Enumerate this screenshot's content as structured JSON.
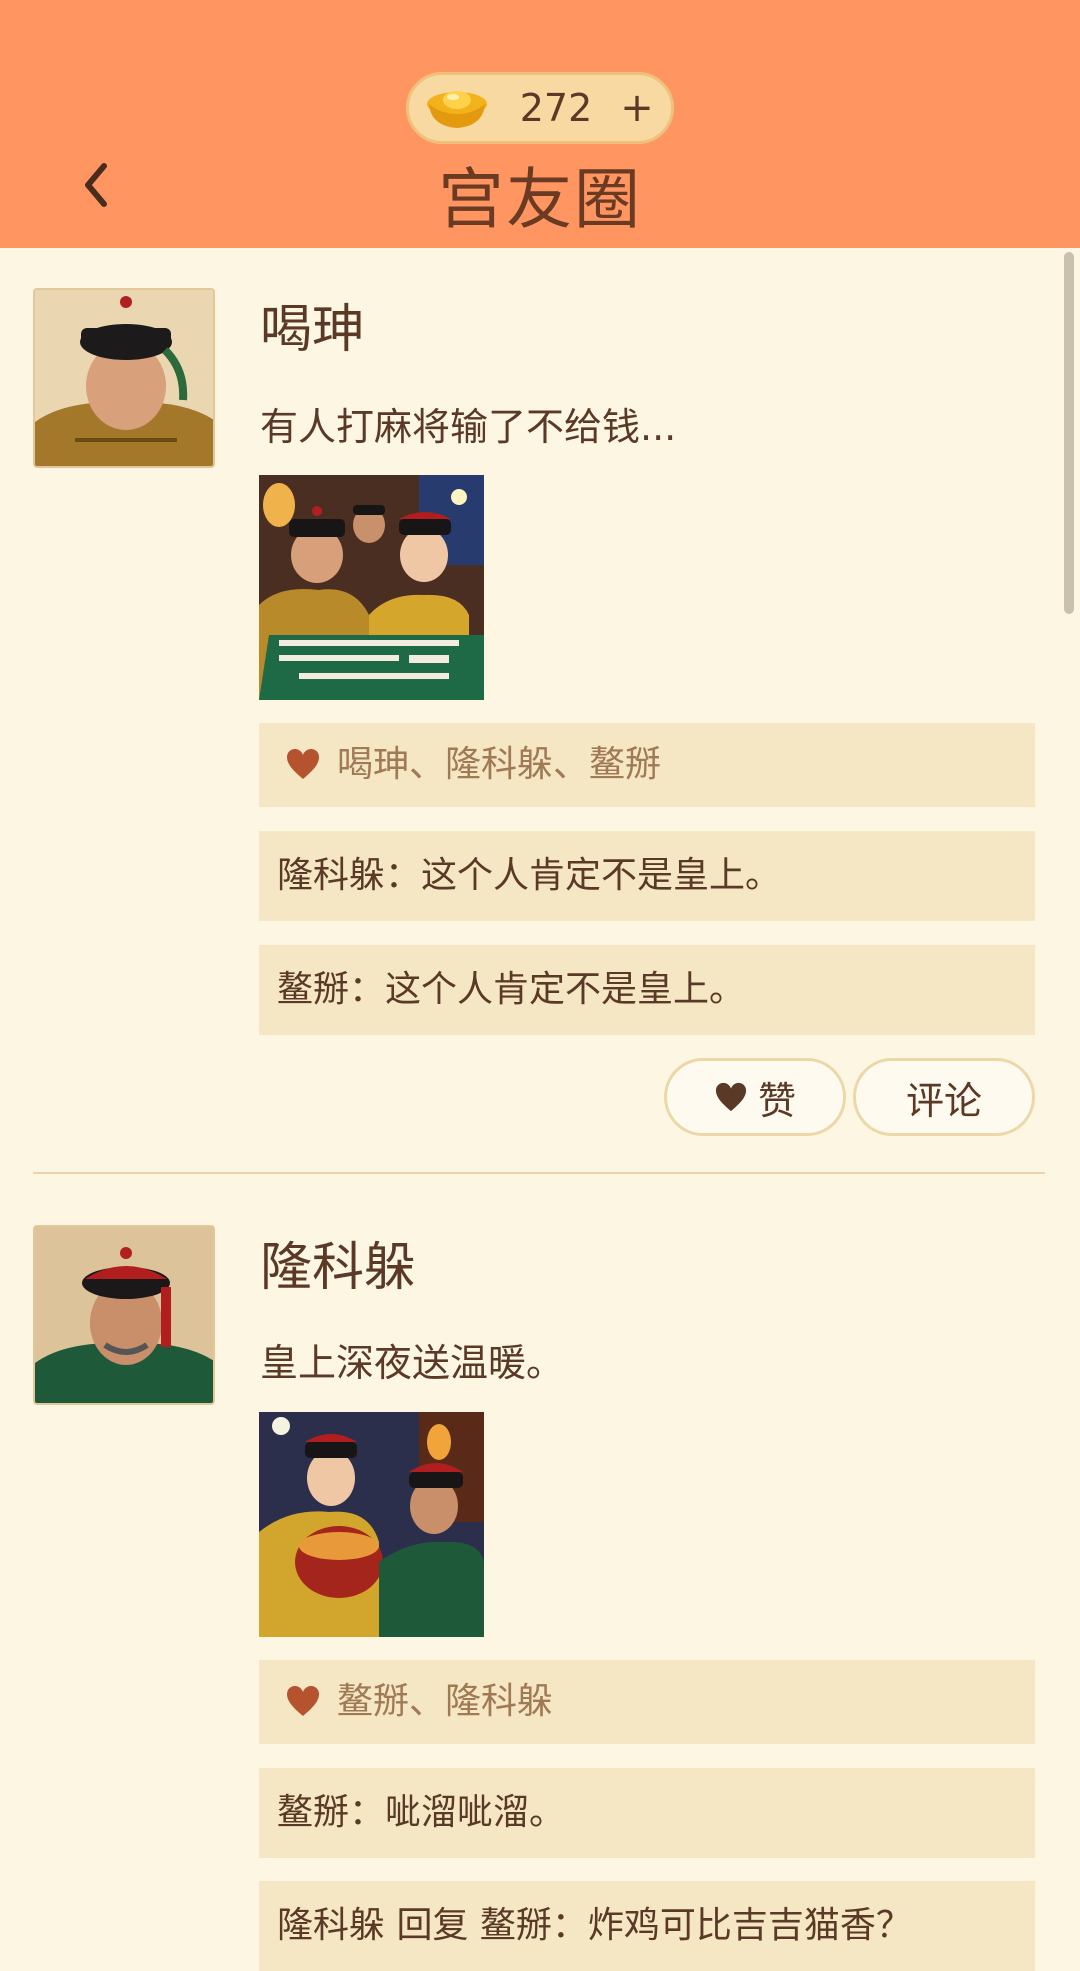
{
  "header": {
    "coins": "272",
    "plus_label": "+",
    "title": "宫友圈",
    "coin_icon": "gold-ingot-icon",
    "back_icon": "chevron-left-icon"
  },
  "colors": {
    "header_bg": "#ff9662",
    "page_bg": "#fdf6e2",
    "panel_bg": "#f5e6c4",
    "text": "#5a3a26",
    "heart": "#b4532e"
  },
  "posts": [
    {
      "name": "喝珅",
      "text": "有人打麻将输了不给钱...",
      "image_alt": "mahjong-scene-image",
      "likes": "喝珅、隆科躲、鳌掰",
      "comments": [
        "隆科躲：这个人肯定不是皇上。",
        "鳌掰：这个人肯定不是皇上。"
      ],
      "like_label": "赞",
      "comment_label": "评论"
    },
    {
      "name": "隆科躲",
      "text": "皇上深夜送温暖。",
      "image_alt": "food-gift-scene-image",
      "likes": "鳌掰、隆科躲",
      "comments": [
        "鳌掰：呲溜呲溜。",
        "隆科躲 回复 鳌掰：炸鸡可比吉吉猫香？"
      ]
    }
  ]
}
